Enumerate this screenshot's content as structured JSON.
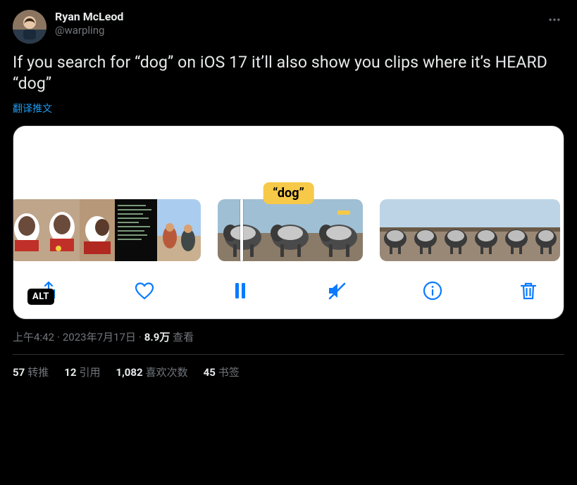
{
  "user": {
    "display_name": "Ryan McLeod",
    "handle": "@warpling"
  },
  "tweet_text": "If you search for “dog” on iOS 17 it’ll also show you clips where it’s HEARD “dog”",
  "translate_label": "翻译推文",
  "media": {
    "caption_label": "“dog”",
    "alt_badge": "ALT",
    "toolbar": {
      "share": "Share",
      "like": "Like",
      "pause": "Pause",
      "mute": "Muted",
      "info": "Info",
      "trash": "Delete"
    }
  },
  "meta": {
    "time": "上午4:42",
    "date": "2023年7月17日",
    "views_count": "8.9万",
    "views_label": "查看"
  },
  "stats": {
    "retweets": {
      "count": "57",
      "label": "转推"
    },
    "quotes": {
      "count": "12",
      "label": "引用"
    },
    "likes": {
      "count": "1,082",
      "label": "喜欢次数"
    },
    "bookmarks": {
      "count": "45",
      "label": "书签"
    }
  }
}
